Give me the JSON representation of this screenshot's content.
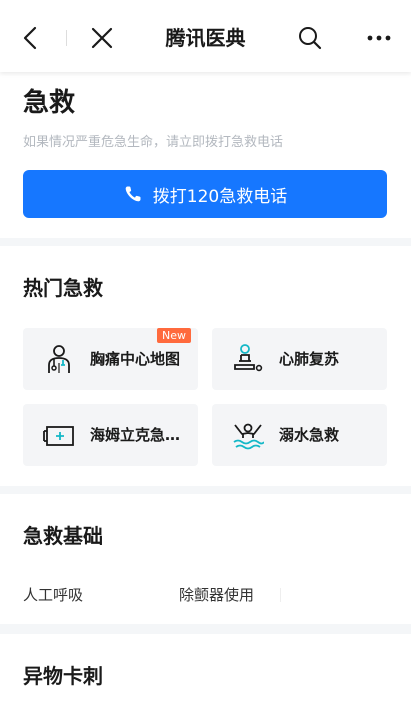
{
  "navbar": {
    "title": "腾讯医典",
    "back_icon": "chevron-left-icon",
    "close_icon": "close-icon",
    "search_icon": "search-icon",
    "more_icon": "more-horizontal-icon"
  },
  "emergency": {
    "heading": "急救",
    "subtitle": "如果情况严重危急生命，请立即拨打急救电话",
    "call_button_label": "拨打120急救电话",
    "call_icon": "phone-icon",
    "accent_color": "#1677ff"
  },
  "hot_section": {
    "title": "热门急救",
    "cards": [
      {
        "label": "胸痛中心地图",
        "icon": "doctor-icon",
        "badge": "New"
      },
      {
        "label": "心肺复苏",
        "icon": "cpr-icon"
      },
      {
        "label": "海姆立克急…",
        "icon": "first-aid-kit-icon"
      },
      {
        "label": "溺水急救",
        "icon": "drowning-icon"
      }
    ]
  },
  "basic_section": {
    "title": "急救基础",
    "items": [
      "人工呼吸",
      "除颤器使用"
    ]
  },
  "foreign_section": {
    "title": "异物卡刺"
  }
}
